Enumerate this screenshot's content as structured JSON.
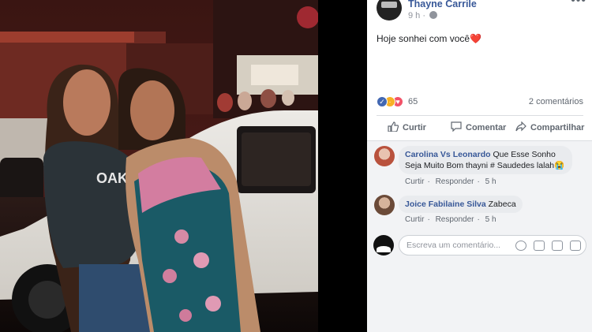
{
  "post": {
    "author": "Thayne Carrile",
    "time": "9 h",
    "text": "Hoje sonhei com você",
    "text_emoji": "❤️",
    "reaction_count": "65",
    "comments_count": "2 comentários"
  },
  "actions": {
    "like": "Curtir",
    "comment": "Comentar",
    "share": "Compartilhar"
  },
  "comments": [
    {
      "name": "Carolina Vs Leonardo",
      "text_line1": "Que Esse Sonho",
      "text_line2": "Seja Muito Bom thayni # Saudedes lalah😭",
      "like": "Curtir",
      "reply": "Responder",
      "time": "5 h"
    },
    {
      "name": "Joice Fabilaine Silva",
      "text": "Zabeca",
      "like": "Curtir",
      "reply": "Responder",
      "time": "5 h"
    }
  ],
  "composer": {
    "placeholder": "Escreva um comentário..."
  },
  "photo": {
    "shirt_text": "OAKL"
  },
  "colors": {
    "brand_link": "#385898",
    "meta": "#90949c",
    "action": "#606770",
    "like_blue": "#4267b2",
    "love_red": "#f25268"
  }
}
